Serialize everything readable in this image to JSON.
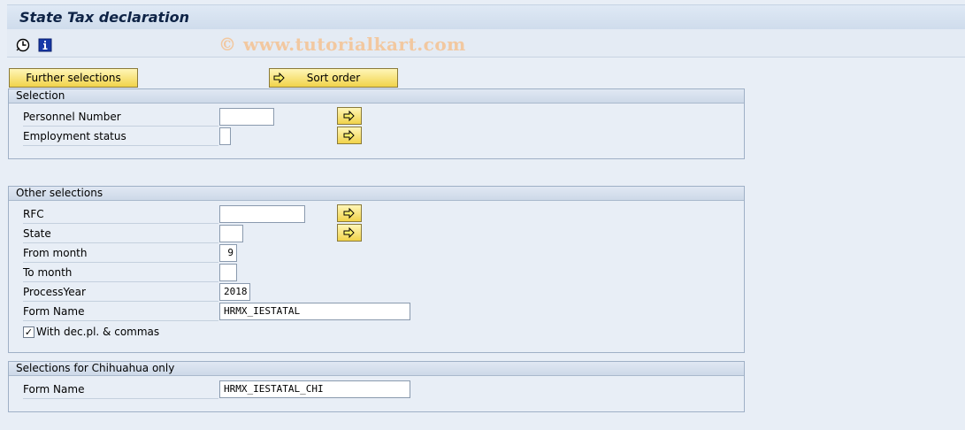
{
  "title": "State Tax declaration",
  "watermark": "© www.tutorialkart.com",
  "toolbar": {
    "icons": [
      "execute-clock-icon",
      "info-icon"
    ],
    "further_selections": "Further selections",
    "sort_order": "Sort order"
  },
  "selection": {
    "header": "Selection",
    "personnel_number": {
      "label": "Personnel Number",
      "value": ""
    },
    "employment_status": {
      "label": "Employment status",
      "value": ""
    }
  },
  "other": {
    "header": "Other selections",
    "rfc": {
      "label": "RFC",
      "value": ""
    },
    "state": {
      "label": "State",
      "value": ""
    },
    "from_month": {
      "label": "From month",
      "value": "9"
    },
    "to_month": {
      "label": "To month",
      "value": ""
    },
    "process_year": {
      "label": "ProcessYear",
      "value": "2018"
    },
    "form_name": {
      "label": "Form Name",
      "value": "HRMX_IESTATAL"
    },
    "checkbox": {
      "label": "With dec.pl. & commas",
      "checked": true,
      "mark": "✓"
    }
  },
  "chihuahua": {
    "header": "Selections for Chihuahua only",
    "form_name": {
      "label": "Form Name",
      "value": "HRMX_IESTATAL_CHI"
    }
  }
}
